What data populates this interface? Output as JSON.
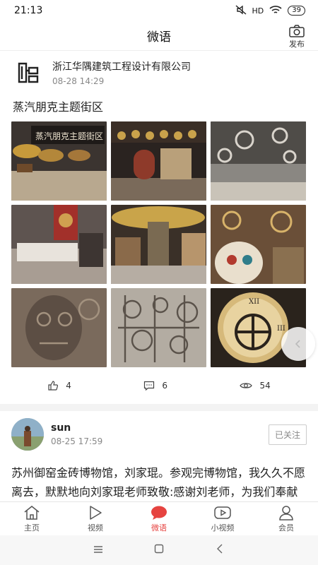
{
  "status_bar": {
    "time": "21:13",
    "signal": "HD",
    "battery": "39"
  },
  "header": {
    "title": "微语",
    "publish_label": "发布"
  },
  "post1": {
    "author": "浙江华隅建筑工程设计有限公司",
    "time": "08-28 14:29",
    "title": "蒸汽朋克主题街区",
    "image_sign_text": "蒸汽朋克主题街区",
    "likes": "4",
    "comments": "6",
    "views": "54"
  },
  "post2": {
    "author": "sun",
    "time": "08-25 17:59",
    "follow_label": "已关注",
    "body": "苏州御窑金砖博物馆，刘家琨。参观完博物馆，我久久不愿离去，默默地向刘家琨老师致敬:感谢刘老师，为我们奉献了一座独特的艺术精品。觉得她像极"
  },
  "tabbar": {
    "items": [
      {
        "label": "主页",
        "icon": "home-icon"
      },
      {
        "label": "视频",
        "icon": "play-icon"
      },
      {
        "label": "微语",
        "icon": "chat-bubble-icon"
      },
      {
        "label": "小视频",
        "icon": "short-video-icon"
      },
      {
        "label": "会员",
        "icon": "user-icon"
      }
    ],
    "active_index": 2
  },
  "colors": {
    "accent": "#e64340",
    "muted": "#888888"
  }
}
